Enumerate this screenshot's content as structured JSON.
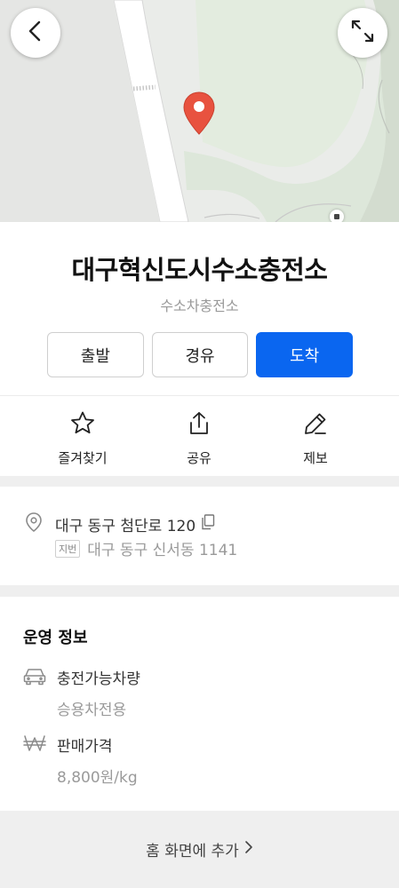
{
  "map": {
    "back_icon": "chevron-left-icon",
    "expand_icon": "expand-icon",
    "pin_icon": "map-pin-icon",
    "pin_color": "#e8523f"
  },
  "place": {
    "title": "대구혁신도시수소충전소",
    "category": "수소차충전소"
  },
  "route": {
    "start": "출발",
    "waypoint": "경유",
    "arrive": "도착",
    "accent": "#0a66f0"
  },
  "actions": {
    "favorite": "즐겨찾기",
    "share": "공유",
    "report": "제보"
  },
  "address": {
    "road": "대구 동구 첨단로 120",
    "jibun_label": "지번",
    "jibun": "대구 동구 신서동 1141"
  },
  "operation": {
    "title": "운영 정보",
    "vehicle_label": "충전가능차량",
    "vehicle_value": "승용차전용",
    "price_label": "판매가격",
    "price_value": "8,800원/kg"
  },
  "footer": {
    "add_home": "홈 화면에 추가"
  }
}
